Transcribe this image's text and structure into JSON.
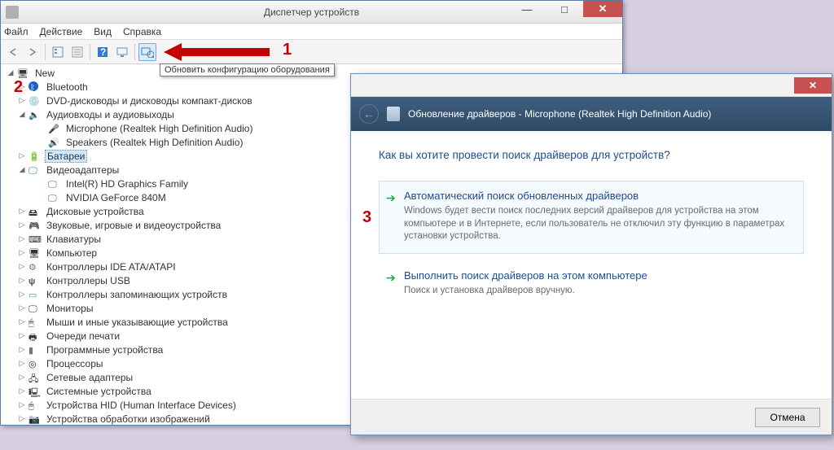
{
  "annotations": {
    "n1": "1",
    "n2": "2",
    "n3": "3"
  },
  "dm": {
    "title": "Диспетчер устройств",
    "menu": {
      "file": "Файл",
      "action": "Действие",
      "view": "Вид",
      "help": "Справка"
    },
    "tooltip": "Обновить конфигурацию оборудования",
    "root": "New",
    "items": {
      "bluetooth": "Bluetooth",
      "dvd": "DVD-дисководы и дисководы компакт-дисков",
      "audio": "Аудиовходы и аудиовыходы",
      "mic": "Microphone (Realtek High Definition Audio)",
      "spk": "Speakers (Realtek High Definition Audio)",
      "battery": "Батареи",
      "video": "Видеоадаптеры",
      "gpu1": "Intel(R) HD Graphics Family",
      "gpu2": "NVIDIA GeForce 840M",
      "disk": "Дисковые устройства",
      "game": "Звуковые, игровые и видеоустройства",
      "kb": "Клавиатуры",
      "computer": "Компьютер",
      "ide": "Контроллеры IDE ATA/ATAPI",
      "usb": "Контроллеры USB",
      "mem": "Контроллеры запоминающих устройств",
      "mon": "Мониторы",
      "mouse": "Мыши и иные указывающие устройства",
      "queue": "Очереди печати",
      "sw": "Программные устройства",
      "cpu": "Процессоры",
      "net": "Сетевые адаптеры",
      "sys": "Системные устройства",
      "hid": "Устройства HID (Human Interface Devices)",
      "img": "Устройства обработки изображений"
    }
  },
  "dlg": {
    "header": "Обновление драйверов - Microphone (Realtek High Definition Audio)",
    "question": "Как вы хотите провести поиск драйверов для устройств?",
    "opt1_title": "Автоматический поиск обновленных драйверов",
    "opt1_desc": "Windows будет вести поиск последних версий драйверов для устройства на этом компьютере и в Интернете, если пользователь не отключил эту функцию в параметрах установки устройства.",
    "opt2_title": "Выполнить поиск драйверов на этом компьютере",
    "opt2_desc": "Поиск и установка драйверов вручную.",
    "cancel": "Отмена"
  }
}
